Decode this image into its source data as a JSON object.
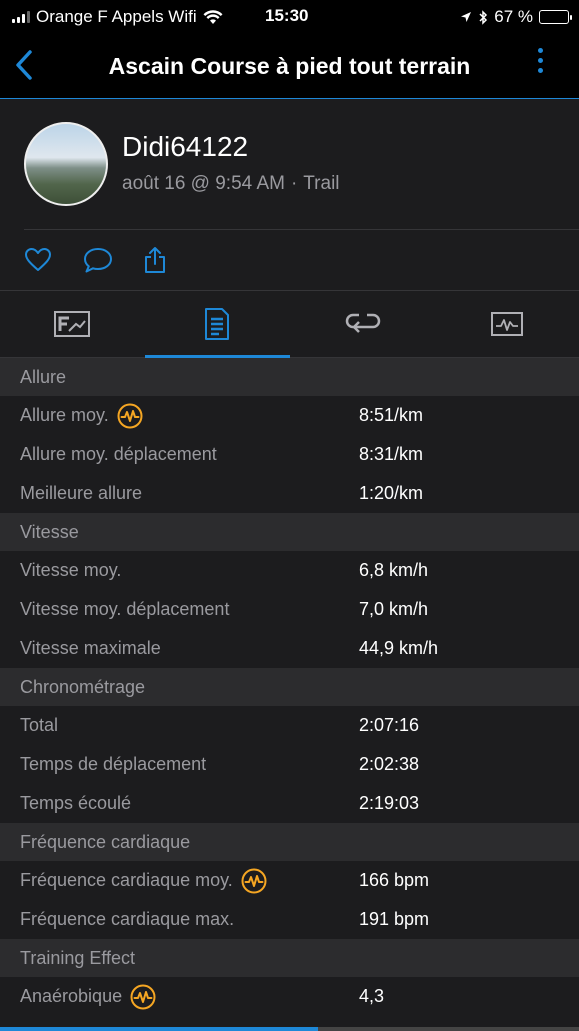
{
  "status_bar": {
    "carrier": "Orange F Appels Wifi",
    "time": "15:30",
    "battery_pct": "67 %"
  },
  "nav": {
    "title": "Ascain Course à pied tout terrain"
  },
  "profile": {
    "username": "Didi64122",
    "date": "août 16 @ 9:54 AM",
    "separator": "·",
    "activity_type": "Trail"
  },
  "sections": [
    {
      "title": "Allure",
      "rows": [
        {
          "label": "Allure moy.",
          "value": "8:51/km",
          "hr_icon": true
        },
        {
          "label": "Allure moy. déplacement",
          "value": "8:31/km",
          "hr_icon": false
        },
        {
          "label": "Meilleure allure",
          "value": "1:20/km",
          "hr_icon": false
        }
      ]
    },
    {
      "title": "Vitesse",
      "rows": [
        {
          "label": "Vitesse moy.",
          "value": "6,8 km/h",
          "hr_icon": false
        },
        {
          "label": "Vitesse moy. déplacement",
          "value": "7,0 km/h",
          "hr_icon": false
        },
        {
          "label": "Vitesse maximale",
          "value": "44,9 km/h",
          "hr_icon": false
        }
      ]
    },
    {
      "title": "Chronométrage",
      "rows": [
        {
          "label": "Total",
          "value": "2:07:16",
          "hr_icon": false
        },
        {
          "label": "Temps de déplacement",
          "value": "2:02:38",
          "hr_icon": false
        },
        {
          "label": "Temps écoulé",
          "value": "2:19:03",
          "hr_icon": false
        }
      ]
    },
    {
      "title": "Fréquence cardiaque",
      "rows": [
        {
          "label": "Fréquence cardiaque moy.",
          "value": "166 bpm",
          "hr_icon": true
        },
        {
          "label": "Fréquence cardiaque max.",
          "value": "191 bpm",
          "hr_icon": false
        }
      ]
    },
    {
      "title": "Training Effect",
      "rows": [
        {
          "label": "Anaérobique",
          "value": "4,3",
          "hr_icon": true
        }
      ]
    }
  ],
  "colors": {
    "accent": "#1e88d7",
    "hr_icon": "#f5a623",
    "background": "#1c1c1e",
    "section_bg": "#2c2c2e"
  }
}
